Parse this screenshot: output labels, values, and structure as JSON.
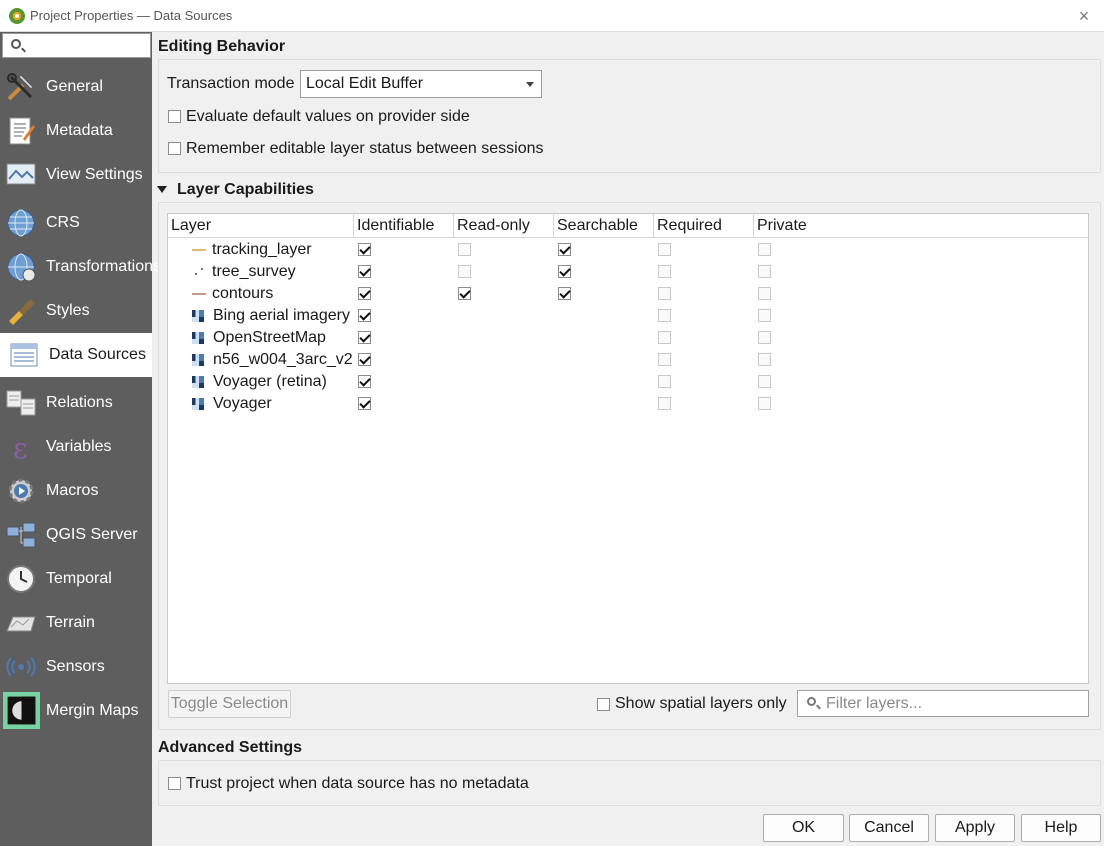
{
  "window": {
    "title": "Project Properties — Data Sources",
    "close_glyph": "×"
  },
  "sidebar": {
    "items": [
      {
        "label": "General",
        "icon": "tools-icon"
      },
      {
        "label": "Metadata",
        "icon": "metadata-icon"
      },
      {
        "label": "View Settings",
        "icon": "view-settings-icon"
      },
      {
        "label": "CRS",
        "icon": "globe-icon"
      },
      {
        "label": "Transformations",
        "icon": "transformation-globe-icon"
      },
      {
        "label": "Styles",
        "icon": "paintbrush-icon"
      },
      {
        "label": "Data Sources",
        "icon": "data-sources-icon"
      },
      {
        "label": "Relations",
        "icon": "relations-icon"
      },
      {
        "label": "Variables",
        "icon": "variables-epsilon-icon"
      },
      {
        "label": "Macros",
        "icon": "macros-gear-icon"
      },
      {
        "label": "QGIS Server",
        "icon": "server-icon"
      },
      {
        "label": "Temporal",
        "icon": "clock-icon"
      },
      {
        "label": "Terrain",
        "icon": "terrain-icon"
      },
      {
        "label": "Sensors",
        "icon": "sensor-icon"
      },
      {
        "label": "Mergin Maps",
        "icon": "mergin-maps-icon"
      }
    ]
  },
  "editing": {
    "title": "Editing Behavior",
    "transaction_label": "Transaction mode",
    "transaction_value": "Local Edit Buffer",
    "eval_defaults_label": "Evaluate default values on provider side",
    "remember_editable_label": "Remember editable layer status between sessions"
  },
  "capabilities": {
    "title": "Layer Capabilities",
    "columns": [
      "Layer",
      "Identifiable",
      "Read-only",
      "Searchable",
      "Required",
      "Private"
    ],
    "rows": [
      {
        "name": "tracking_layer",
        "kind": "line",
        "identifiable": true,
        "readonly": false,
        "searchable": true,
        "required": false,
        "private": false
      },
      {
        "name": "tree_survey",
        "kind": "point",
        "identifiable": true,
        "readonly": false,
        "searchable": true,
        "required": false,
        "private": false
      },
      {
        "name": "contours",
        "kind": "line2",
        "identifiable": true,
        "readonly": true,
        "searchable": true,
        "required": false,
        "private": false
      },
      {
        "name": "Bing aerial imagery",
        "kind": "raster",
        "identifiable": true,
        "readonly": null,
        "searchable": null,
        "required": false,
        "private": false
      },
      {
        "name": "OpenStreetMap",
        "kind": "raster",
        "identifiable": true,
        "readonly": null,
        "searchable": null,
        "required": false,
        "private": false
      },
      {
        "name": "n56_w004_3arc_v2",
        "kind": "raster",
        "identifiable": true,
        "readonly": null,
        "searchable": null,
        "required": false,
        "private": false
      },
      {
        "name": "Voyager (retina)",
        "kind": "raster",
        "identifiable": true,
        "readonly": null,
        "searchable": null,
        "required": false,
        "private": false
      },
      {
        "name": "Voyager",
        "kind": "raster",
        "identifiable": true,
        "readonly": null,
        "searchable": null,
        "required": false,
        "private": false
      }
    ],
    "toggle_selection": "Toggle Selection",
    "spatial_only_label": "Show spatial layers only",
    "filter_placeholder": "Filter layers..."
  },
  "advanced": {
    "title": "Advanced Settings",
    "trust_label": "Trust project when data source has no metadata"
  },
  "buttons": {
    "ok": "OK",
    "cancel": "Cancel",
    "apply": "Apply",
    "help": "Help"
  }
}
